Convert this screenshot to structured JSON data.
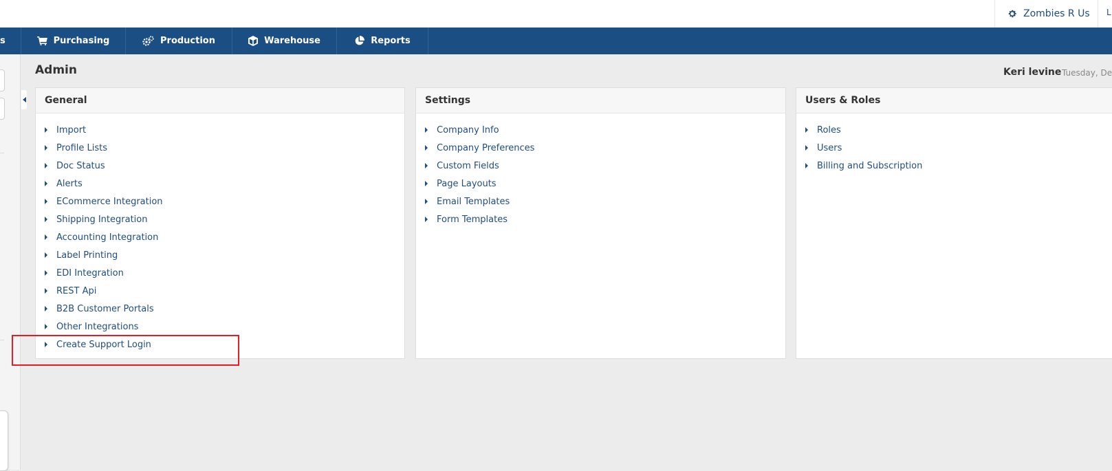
{
  "topbar": {
    "company_name": "Zombies R Us",
    "cut_letter": "L"
  },
  "nav": {
    "left_stub": "s",
    "items": [
      {
        "label": "Purchasing",
        "icon": "cart-icon"
      },
      {
        "label": "Production",
        "icon": "gears-icon"
      },
      {
        "label": "Warehouse",
        "icon": "box-icon"
      },
      {
        "label": "Reports",
        "icon": "pie-chart-icon"
      }
    ]
  },
  "page": {
    "title": "Admin",
    "user": "Keri levine",
    "date": "Tuesday, Dec"
  },
  "cards": [
    {
      "title": "General",
      "items": [
        "Import",
        "Profile Lists",
        "Doc Status",
        "Alerts",
        "ECommerce Integration",
        "Shipping Integration",
        "Accounting Integration",
        "Label Printing",
        "EDI Integration",
        "REST Api",
        "B2B Customer Portals",
        "Other Integrations",
        "Create Support Login"
      ]
    },
    {
      "title": "Settings",
      "items": [
        "Company Info",
        "Company Preferences",
        "Custom Fields",
        "Page Layouts",
        "Email Templates",
        "Form Templates"
      ]
    },
    {
      "title": "Users & Roles",
      "items": [
        "Roles",
        "Users",
        "Billing and Subscription"
      ]
    }
  ],
  "colors": {
    "navbar": "#1b4e82",
    "link": "#1f4e7f",
    "highlight": "#e51c23",
    "background": "#ececec"
  }
}
